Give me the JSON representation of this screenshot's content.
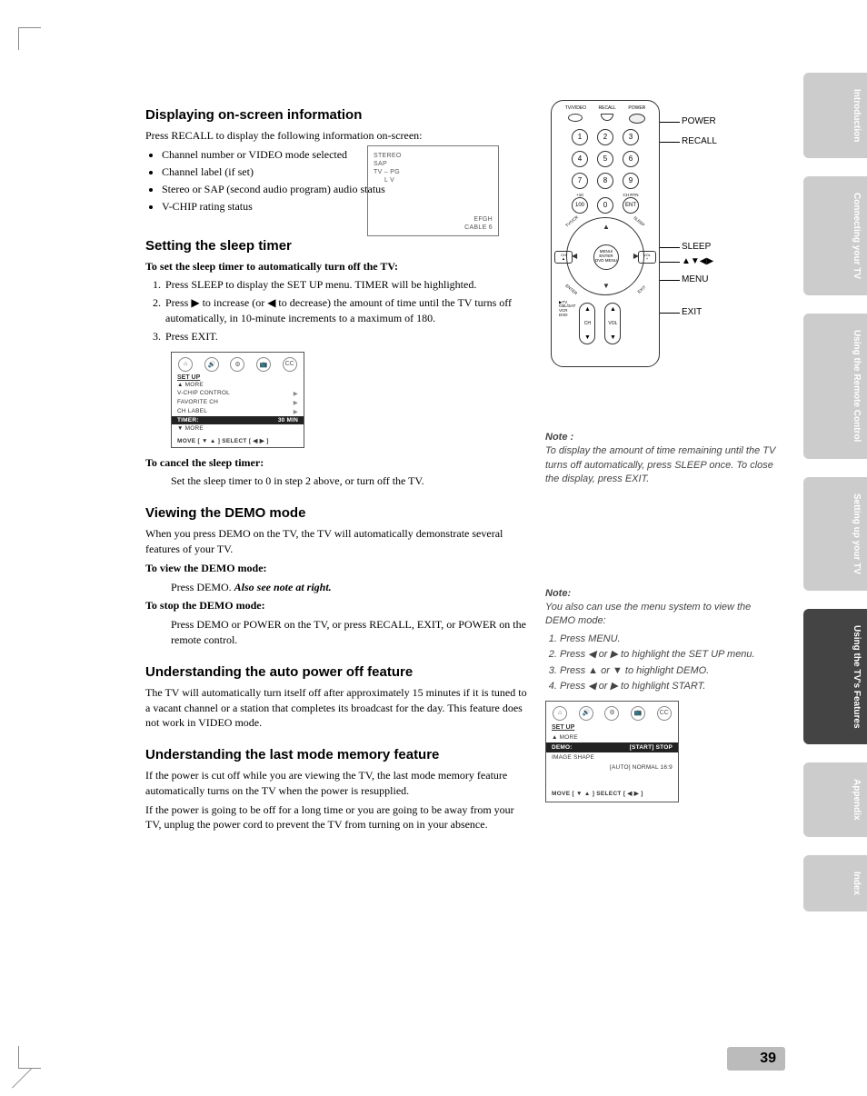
{
  "page_number": "39",
  "side_tabs": [
    "Introduction",
    "Connecting your TV",
    "Using the Remote Control",
    "Setting up your TV",
    "Using the TV's Features",
    "Appendix",
    "Index"
  ],
  "active_tab_index": 4,
  "h_display": "Displaying on-screen information",
  "p_display_intro": "Press RECALL to display the following information on-screen:",
  "bullets_display": [
    "Channel number or VIDEO mode selected",
    "Channel label (if set)",
    "Stereo or SAP (second audio program) audio status",
    "V-CHIP rating status"
  ],
  "osd": {
    "l1": "STEREO",
    "l2": "SAP",
    "l3": "TV – PG",
    "l4": "L   V",
    "b1": "EFGH",
    "b2": "CABLE     6"
  },
  "h_sleep": "Setting the sleep timer",
  "p_sleep_sub": "To set the sleep timer to automatically turn off the TV:",
  "steps_sleep": [
    "Press SLEEP to display the SET UP menu. TIMER will be highlighted.",
    "Press ▶ to increase (or ◀ to decrease) the amount of time until the TV turns off automatically, in 10-minute increments to a maximum of 180.",
    "Press EXIT."
  ],
  "menu_sleep": {
    "title": "SET UP",
    "rows": [
      {
        "label": "▲ MORE",
        "arrow": ""
      },
      {
        "label": "V-CHIP CONTROL",
        "arrow": "▶"
      },
      {
        "label": "FAVORITE CH",
        "arrow": "▶"
      },
      {
        "label": "CH LABEL",
        "arrow": "▶"
      }
    ],
    "hl_label": "TIMER:",
    "hl_val": "30 MIN",
    "more": "▼ MORE",
    "foot": "MOVE [ ▼ ▲ ]      SELECT [ ◀  ▶ ]"
  },
  "p_sleep_cancel_h": "To cancel the sleep timer:",
  "p_sleep_cancel": "Set the sleep timer to 0 in step 2 above, or turn off the TV.",
  "h_demo": "Viewing the DEMO mode",
  "p_demo_intro": "When you press DEMO on the TV, the TV will automatically demonstrate several features of your TV.",
  "p_demo_view_h": "To view the DEMO mode:",
  "p_demo_view": "Press DEMO. ",
  "p_demo_view_em": "Also see note at right.",
  "p_demo_stop_h": "To stop the DEMO mode:",
  "p_demo_stop": "Press DEMO or POWER on the TV, or press RECALL, EXIT, or POWER on the remote control.",
  "h_auto": "Understanding the auto power off feature",
  "p_auto": "The TV will automatically turn itself off after approximately 15 minutes if it is tuned to a vacant channel or a station that completes its broadcast for the day. This feature does not work in VIDEO mode.",
  "h_last": "Understanding the last mode memory feature",
  "p_last1": "If the power is cut off while you are viewing the TV, the last mode memory feature automatically turns on the TV when the power is resupplied.",
  "p_last2": "If the power is going to be off for a long time or you are going to be away from your TV, unplug the power cord to prevent the TV from turning on in your absence.",
  "remote_callouts": {
    "power": "POWER",
    "recall": "RECALL",
    "sleep": "SLEEP",
    "arrows": "▲▼◀▶",
    "menu": "MENU",
    "exit": "EXIT"
  },
  "remote": {
    "top": [
      "TV/VIDEO",
      "RECALL",
      "POWER"
    ],
    "nums": [
      "1",
      "2",
      "3",
      "4",
      "5",
      "6",
      "7",
      "8",
      "9"
    ],
    "row4": [
      "100",
      "0",
      "ENT"
    ],
    "row4_lbl": [
      "+10",
      "",
      "CH RTN"
    ],
    "center": "MENU/\nENTER\nDVD MENU",
    "side_l": "CH ▲\n▼",
    "side_r": "VOL +\n–",
    "corners": [
      "TV/VCR",
      "SLEEP",
      "ENTER",
      "EXIT"
    ],
    "modes": [
      "▶TV",
      "CBL/SAT",
      "VCR",
      "DVD"
    ],
    "rockers": [
      "CH",
      "VOL"
    ]
  },
  "note1_title": "Note :",
  "note1_body": "To display the amount of time remaining until the TV turns off automatically, press SLEEP once. To close the display, press EXIT.",
  "note2_title": "Note:",
  "note2_intro": "You also can use the menu system to view the DEMO mode:",
  "note2_steps": [
    "Press MENU.",
    "Press ◀ or ▶ to highlight the SET UP menu.",
    "Press ▲ or ▼ to highlight DEMO.",
    "Press ◀ or ▶ to highlight START."
  ],
  "menu_demo": {
    "title": "SET UP",
    "more": "▲ MORE",
    "hl_label": "DEMO:",
    "hl_val": "[START] STOP",
    "row2_l": "IMAGE SHAPE",
    "row2_v": "[AUTO] NORMAL 16:9",
    "foot": "MOVE [ ▼ ▲ ]      SELECT [ ◀  ▶ ]"
  },
  "menu_icons": [
    "⌂",
    "🔊",
    "⚙",
    "📺",
    "CC"
  ]
}
